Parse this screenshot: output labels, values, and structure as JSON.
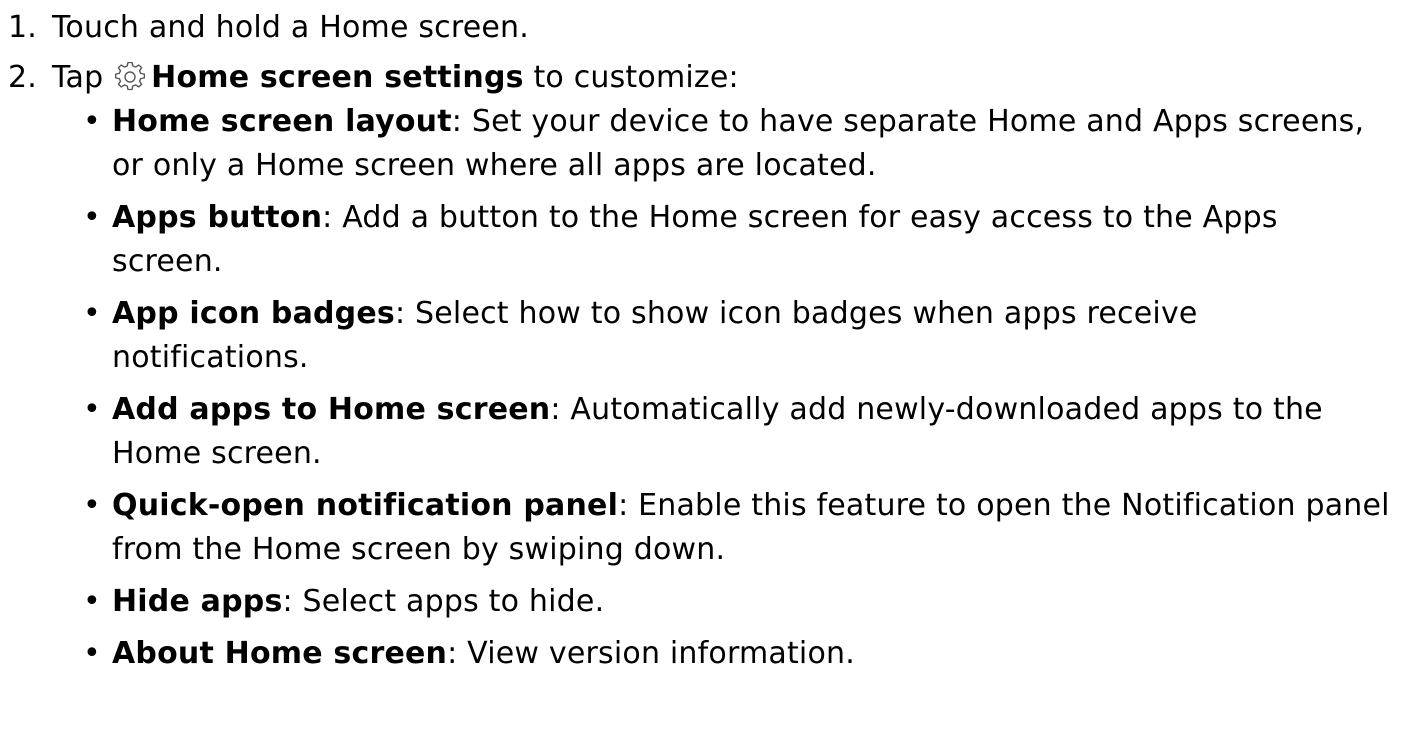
{
  "steps": [
    {
      "number": "1.",
      "text": "Touch and hold a Home screen."
    },
    {
      "number": "2.",
      "prefix": "Tap",
      "icon": "gear-icon",
      "bold": "Home screen settings",
      "suffix": " to customize:"
    }
  ],
  "bullets": [
    {
      "term": "Home screen layout",
      "desc": ": Set your device to have separate Home and Apps screens, or only a Home screen where all apps are located."
    },
    {
      "term": "Apps button",
      "desc": ": Add a button to the Home screen for easy access to the Apps screen."
    },
    {
      "term": "App icon badges",
      "desc": ": Select how to show icon badges when apps receive notifications."
    },
    {
      "term": "Add apps to Home screen",
      "desc": ": Automatically add newly-downloaded apps to the Home screen."
    },
    {
      "term": "Quick-open notification panel",
      "desc": ": Enable this feature to open the Notification panel from the Home screen by swiping down."
    },
    {
      "term": "Hide apps",
      "desc": ": Select apps to hide."
    },
    {
      "term": "About Home screen",
      "desc": ": View version information."
    }
  ]
}
